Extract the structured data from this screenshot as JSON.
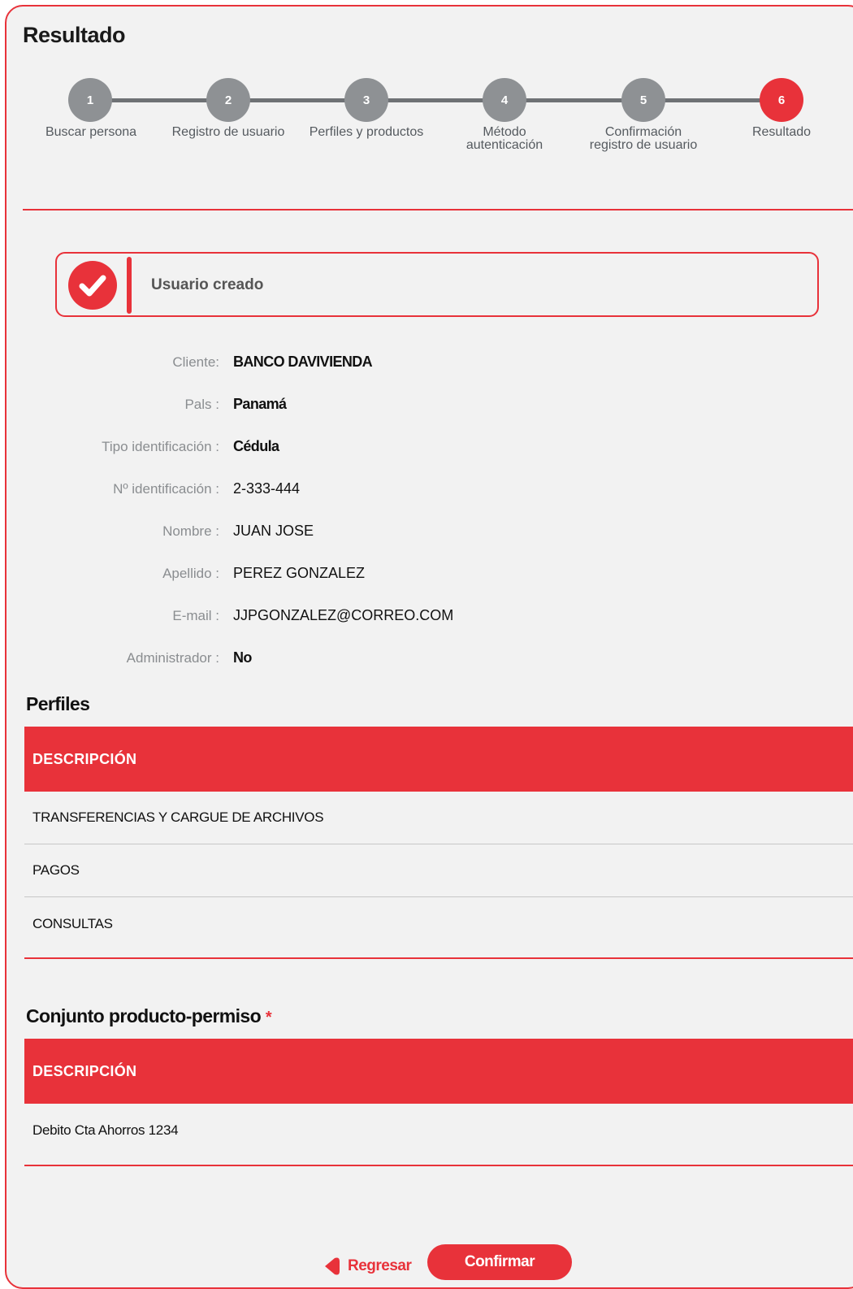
{
  "page": {
    "title": "Resultado"
  },
  "stepper": {
    "steps": [
      {
        "number": "1",
        "label": "Buscar persona",
        "active": false
      },
      {
        "number": "2",
        "label": "Registro de usuario",
        "active": false
      },
      {
        "number": "3",
        "label": "Perfiles y productos",
        "active": false
      },
      {
        "number": "4",
        "label_line1": "Método",
        "label_line2": "autenticación",
        "active": false
      },
      {
        "number": "5",
        "label_line1": "Confirmación",
        "label_line2": "registro de usuario",
        "active": false
      },
      {
        "number": "6",
        "label": "Resultado",
        "active": true
      }
    ]
  },
  "alert": {
    "message": "Usuario creado",
    "icon": "check-circle-icon"
  },
  "details": [
    {
      "label": "Cliente:",
      "value": "BANCO DAVIVIENDA"
    },
    {
      "label": "Pals :",
      "value": "Panamá"
    },
    {
      "label": "Tipo identificación :",
      "value": "Cédula"
    },
    {
      "label": "Nº identificación :",
      "value": "2-333-444"
    },
    {
      "label": "Nombre :",
      "value": "JUAN JOSE"
    },
    {
      "label": "Apellido :",
      "value": "PEREZ GONZALEZ"
    },
    {
      "label": "E-mail :",
      "value": "JJPGONZALEZ@CORREO.COM"
    },
    {
      "label": "Administrador :",
      "value": "No"
    }
  ],
  "profiles": {
    "title": "Perfiles",
    "header": "DESCRIPCIÓN",
    "rows": [
      "TRANSFERENCIAS Y CARGUE DE ARCHIVOS",
      "PAGOS",
      "CONSULTAS"
    ]
  },
  "product_permissions": {
    "title": "Conjunto producto-permiso",
    "required_mark": "*",
    "header": "DESCRIPCIÓN",
    "rows": [
      "Debito Cta Ahorros 1234"
    ]
  },
  "actions": {
    "back_label": "Regresar",
    "confirm_label": "Confirmar"
  },
  "colors": {
    "accent": "#e8323a",
    "step_inactive": "#8e9194",
    "background": "#f2f2f2"
  }
}
